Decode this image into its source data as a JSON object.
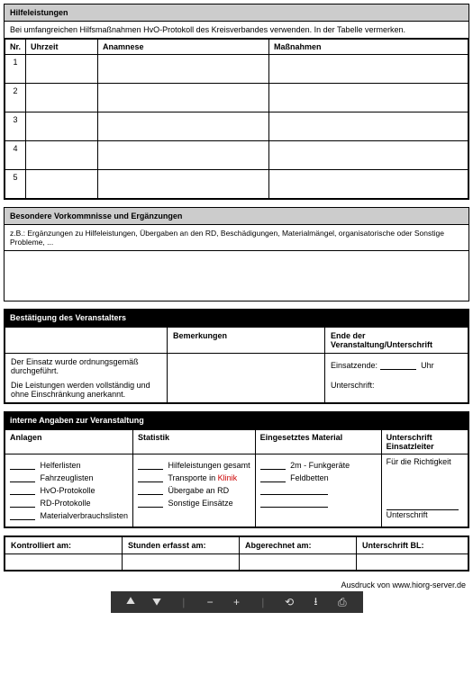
{
  "hilfeleistungen": {
    "title": "Hilfeleistungen",
    "note": "Bei umfangreichen Hilfsmaßnahmen HvO-Protokoll des Kreisverbandes verwenden. In der Tabelle vermerken.",
    "headers": {
      "nr": "Nr.",
      "uhrzeit": "Uhrzeit",
      "anamnese": "Anamnese",
      "massnahmen": "Maßnahmen"
    },
    "rows": [
      "1",
      "2",
      "3",
      "4",
      "5"
    ]
  },
  "besondere": {
    "title": "Besondere Vorkommnisse und Ergänzungen",
    "hint": "z.B.: Ergänzungen zu Hilfeleistungen, Übergaben an den RD, Beschädigungen, Materialmängel, organisatorische oder Sonstige Probleme, ..."
  },
  "bestaetigung": {
    "title": "Bestätigung des Veranstalters",
    "col2": "Bemerkungen",
    "col3": "Ende der Veranstaltung/Unterschrift",
    "line1": "Der Einsatz wurde ordnungsgemäß durchgeführt.",
    "line2": "Die Leistungen werden vollständig und ohne Einschränkung anerkannt.",
    "einsatzende": "Einsatzende:",
    "uhr": "Uhr",
    "unterschrift": "Unterschrift:"
  },
  "interne": {
    "title": "interne Angaben zur Veranstaltung",
    "headers": {
      "anlagen": "Anlagen",
      "statistik": "Statistik",
      "material": "Eingesetztes Material",
      "unterschrift": "Unterschrift Einsatzleiter"
    },
    "anlagen": [
      "Helferlisten",
      "Fahrzeuglisten",
      "HvO-Protokolle",
      "RD-Protokolle",
      "Materialverbrauchslisten"
    ],
    "statistik": [
      "Hilfeleistungen gesamt",
      "Transporte in Klinik",
      "Übergabe an RD",
      "Sonstige Einsätze"
    ],
    "material": [
      "2m - Funkgeräte",
      "Feldbetten"
    ],
    "richtigkeit": "Für die Richtigkeit",
    "unterschrift_label": "Unterschrift"
  },
  "controls": {
    "kontrolliert": "Kontrolliert am:",
    "stunden": "Stunden erfasst am:",
    "abgerechnet": "Abgerechnet am:",
    "unterschrift_bl": "Unterschrift BL:"
  },
  "footer": "Ausdruck von www.hiorg-server.de"
}
